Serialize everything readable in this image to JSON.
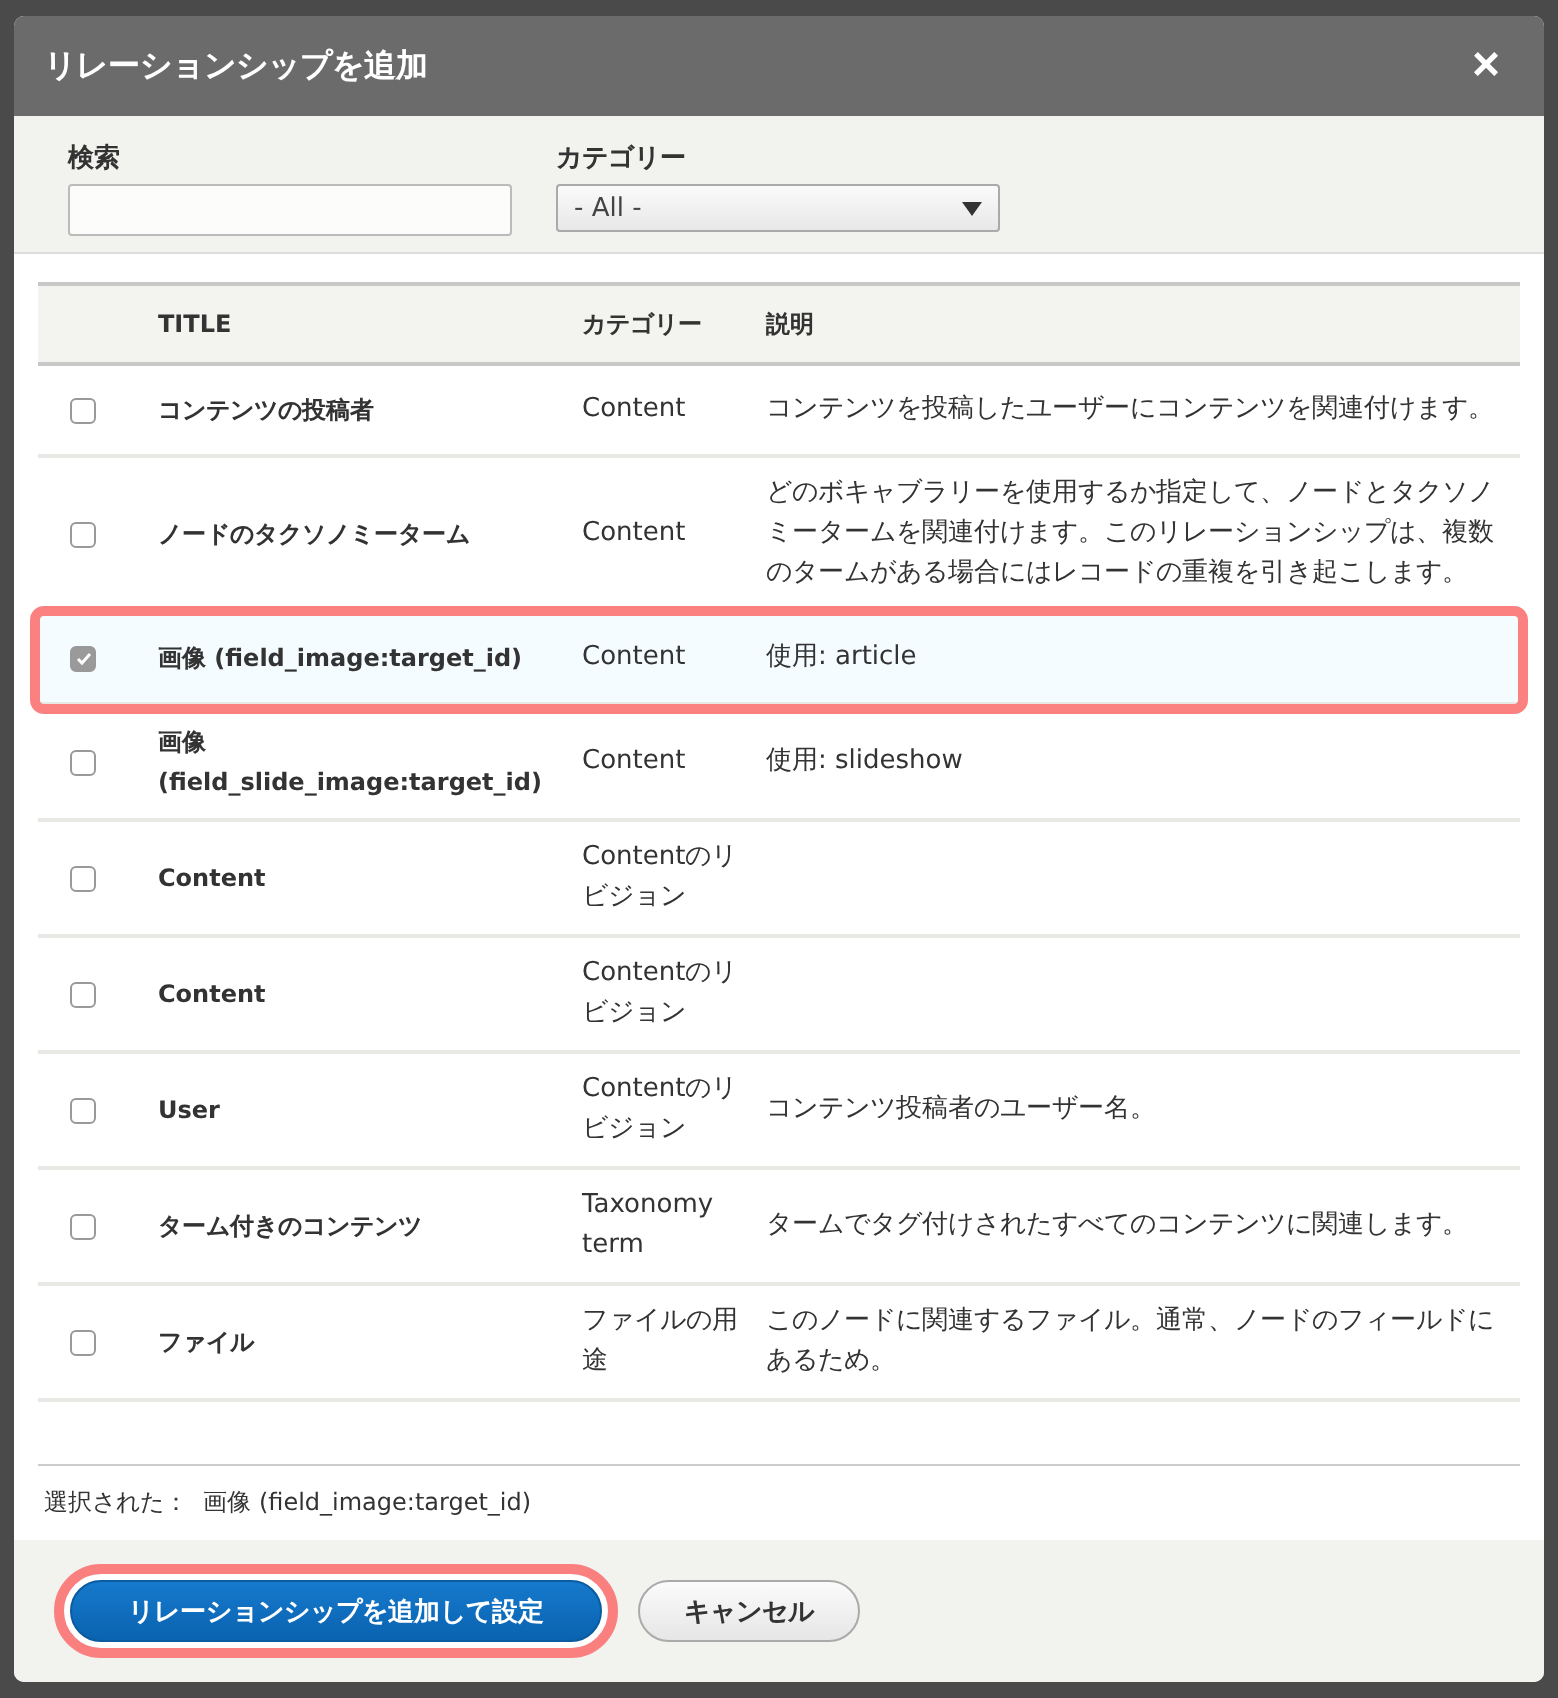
{
  "dialog": {
    "title": "リレーションシップを追加",
    "close": "×"
  },
  "filters": {
    "search": {
      "label": "検索"
    },
    "category": {
      "label": "カテゴリー",
      "value": "- All -"
    }
  },
  "table": {
    "columns": [
      "TITLE",
      "カテゴリー",
      "説明"
    ],
    "rows": [
      {
        "title": "コンテンツの投稿者",
        "category": "Content",
        "description": "コンテンツを投稿したユーザーにコンテンツを関連付けます。",
        "selected": false,
        "highlighted": false
      },
      {
        "title": "ノードのタクソノミーターム",
        "category": "Content",
        "description": "どのボキャブラリーを使用するか指定して、ノードとタクソノミータームを関連付けます。このリレーションシップは、複数のタームがある場合にはレコードの重複を引き起こします。",
        "selected": false,
        "highlighted": false
      },
      {
        "title": "画像 (field_image:target_id)",
        "category": "Content",
        "description": "使用: article",
        "selected": true,
        "highlighted": true
      },
      {
        "title": "画像 (field_slide_image:target_id)",
        "category": "Content",
        "description": "使用: slideshow",
        "selected": false,
        "highlighted": false
      },
      {
        "title": "Content",
        "category": "Contentのリビジョン",
        "selected": false,
        "highlighted": false
      },
      {
        "title": "Content",
        "category": "Contentのリビジョン",
        "selected": false,
        "highlighted": false
      },
      {
        "title": "User",
        "category": "Contentのリビジョン",
        "description": "コンテンツ投稿者のユーザー名。",
        "selected": false,
        "highlighted": false
      },
      {
        "title": "ターム付きのコンテンツ",
        "category": "Taxonomy term",
        "description": "タームでタグ付けされたすべてのコンテンツに関連します。",
        "selected": false,
        "highlighted": false
      },
      {
        "title": "ファイル",
        "category": "ファイルの用途",
        "description": "このノードに関連するファイル。通常、ノードのフィールドにあるため。",
        "selected": false,
        "highlighted": false
      }
    ]
  },
  "selection": {
    "label": "選択された：",
    "value": "画像 (field_image:target_id)"
  },
  "buttons": [
    {
      "label": "リレーションシップを追加して設定",
      "kind": "primary",
      "highlighted": true
    },
    {
      "label": "キャンセル",
      "kind": "secondary",
      "highlighted": false
    }
  ]
}
